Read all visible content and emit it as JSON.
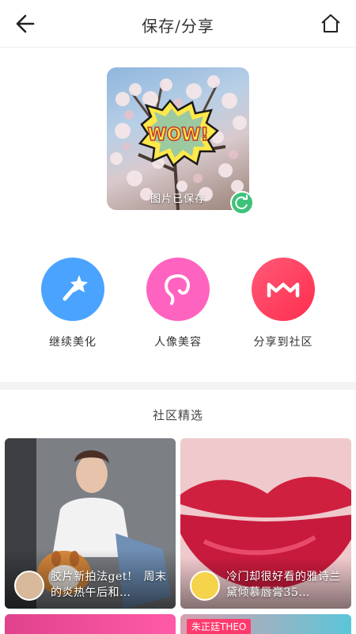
{
  "header": {
    "title": "保存/分享",
    "back_icon": "arrow-left-icon",
    "home_icon": "home-icon"
  },
  "preview": {
    "saved_label": "图片已保存",
    "sticker_text": "WOW!",
    "refresh_icon": "refresh-icon"
  },
  "actions": [
    {
      "label": "继续美化",
      "icon": "magic-wand-icon",
      "color": "#4aa3ff"
    },
    {
      "label": "人像美容",
      "icon": "face-icon",
      "color": "#ff63c0"
    },
    {
      "label": "分享到社区",
      "icon": "meitu-m-icon",
      "color": "#ff3a5c"
    }
  ],
  "community": {
    "title": "社区精选",
    "cards": [
      {
        "caption": "胶片新拍法get!　周末的炎热午后和…"
      },
      {
        "caption": "冷门却很好看的雅诗兰黛倾慕唇膏35…"
      }
    ],
    "peek_tag": "朱正廷THEO"
  }
}
